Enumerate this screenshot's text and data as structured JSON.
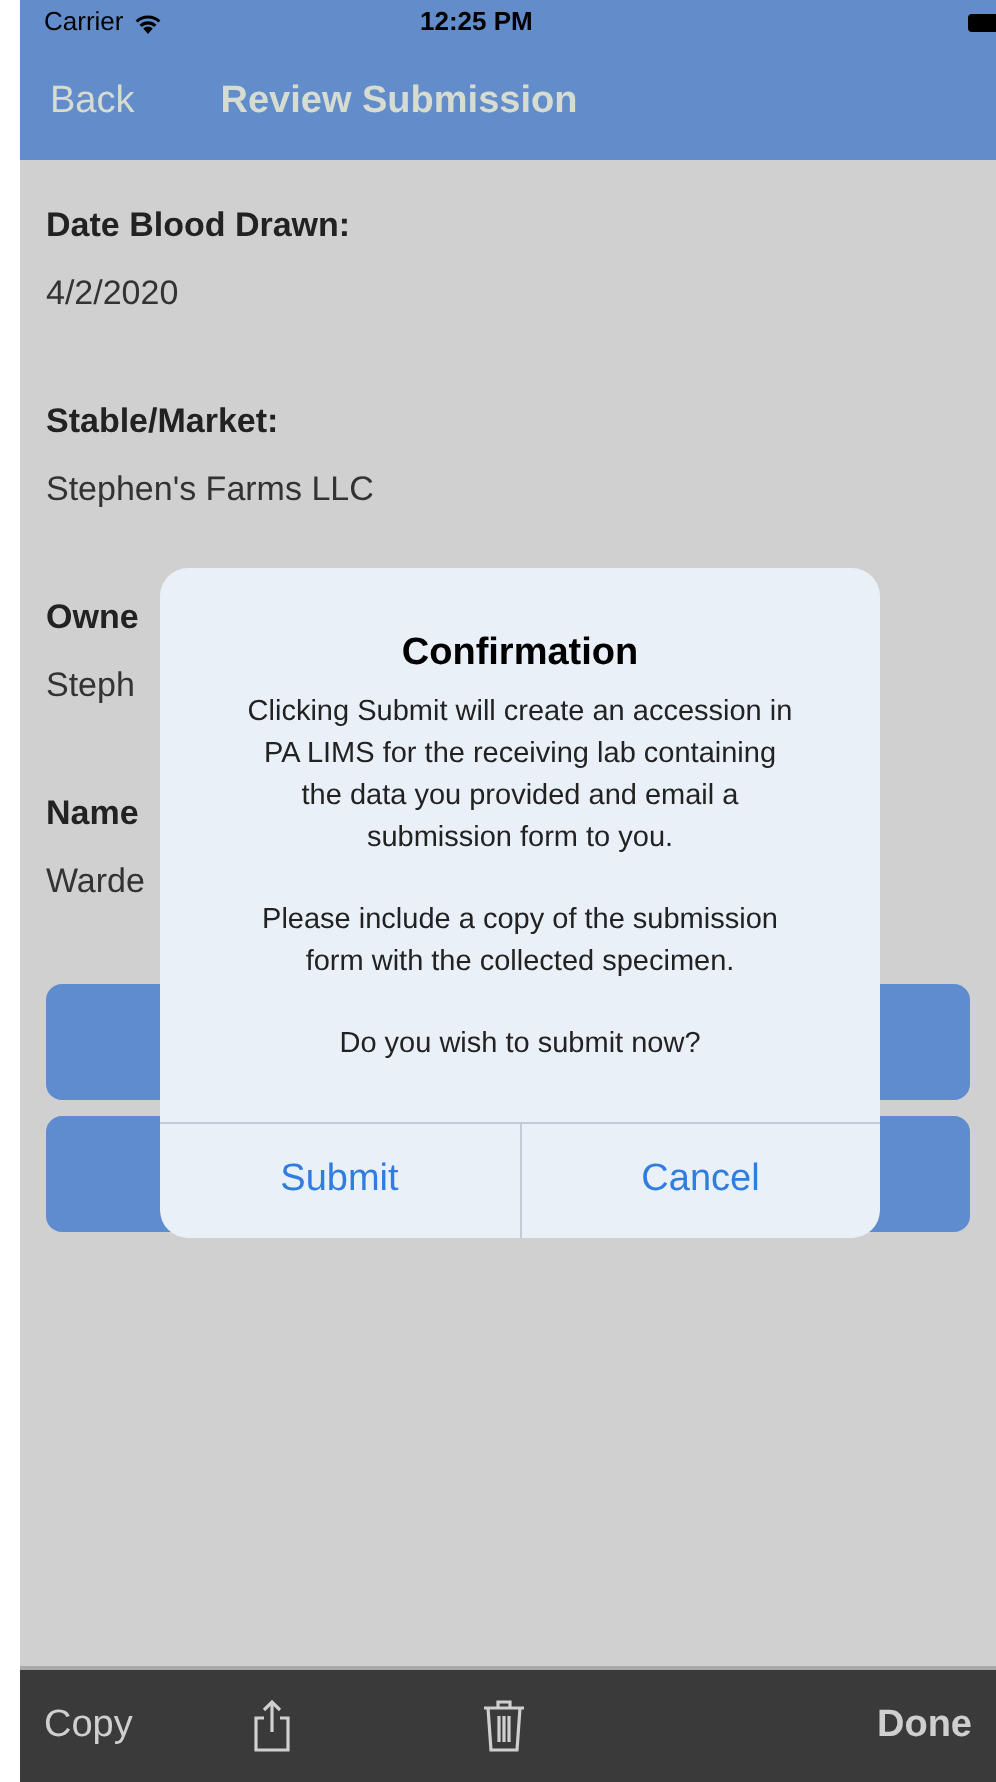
{
  "status_bar": {
    "carrier": "Carrier",
    "time": "12:25 PM"
  },
  "nav_bar": {
    "back": "Back",
    "title": "Review Submission"
  },
  "fields": [
    {
      "label": "Date Blood Drawn:",
      "value": "4/2/2020"
    },
    {
      "label": "Stable/Market:",
      "value": "Stephen's Farms LLC"
    },
    {
      "label": "Owne",
      "value": "Steph"
    },
    {
      "label": "Name",
      "value": "Warde"
    }
  ],
  "buttons": [
    {
      "kind": "action"
    },
    {
      "kind": "action"
    }
  ],
  "dialog": {
    "title": "Confirmation",
    "message": [
      "Clicking Submit will create an accession in PA LIMS for the receiving lab containing the data you provided and email a submission form to you.",
      "Please include a copy of the submission form with the collected specimen.",
      "Do you wish to submit now?"
    ],
    "actions": [
      "Submit",
      "Cancel"
    ]
  },
  "toolbar": {
    "left": "Copy",
    "right": "Done"
  }
}
